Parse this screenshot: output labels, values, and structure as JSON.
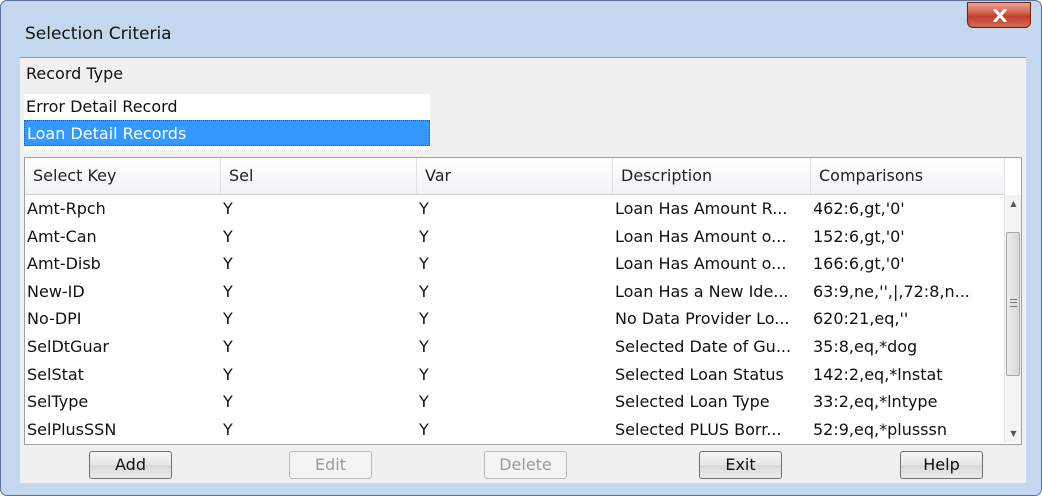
{
  "window": {
    "title": "Selection Criteria"
  },
  "record_type": {
    "label": "Record Type",
    "items": [
      {
        "label": "Error Detail Record",
        "selected": false
      },
      {
        "label": "Loan Detail Records",
        "selected": true
      }
    ]
  },
  "grid": {
    "columns": [
      "Select Key",
      "Sel",
      "Var",
      "Description",
      "Comparisons"
    ],
    "rows": [
      [
        "Amt-Rpch",
        "Y",
        "Y",
        "Loan Has Amount R...",
        "462:6,gt,'0'"
      ],
      [
        "Amt-Can",
        "Y",
        "Y",
        "Loan Has Amount o...",
        "152:6,gt,'0'"
      ],
      [
        "Amt-Disb",
        "Y",
        "Y",
        "Loan Has Amount o...",
        "166:6,gt,'0'"
      ],
      [
        "New-ID",
        "Y",
        "Y",
        "Loan Has a New Ide...",
        "63:9,ne,'',|,72:8,n..."
      ],
      [
        "No-DPI",
        "Y",
        "Y",
        "No Data Provider Lo...",
        "620:21,eq,''"
      ],
      [
        "SelDtGuar",
        "Y",
        "Y",
        "Selected Date of Gu...",
        "35:8,eq,*dog"
      ],
      [
        "SelStat",
        "Y",
        "Y",
        "Selected Loan Status",
        "142:2,eq,*lnstat"
      ],
      [
        "SelType",
        "Y",
        "Y",
        "Selected Loan Type",
        "33:2,eq,*lntype"
      ],
      [
        "SelPlusSSN",
        "Y",
        "Y",
        "Selected PLUS Borr...",
        "52:9,eq,*plusssn"
      ]
    ]
  },
  "buttons": {
    "add": "Add",
    "edit": "Edit",
    "delete": "Delete",
    "exit": "Exit",
    "help": "Help"
  },
  "colors": {
    "window_frame": "#c3d7ef",
    "selection": "#3399ff",
    "close_button": "#c94a36"
  },
  "icons": {
    "close": "close-icon",
    "scroll_up": "scroll-up-arrow-icon",
    "scroll_down": "scroll-down-arrow-icon"
  }
}
